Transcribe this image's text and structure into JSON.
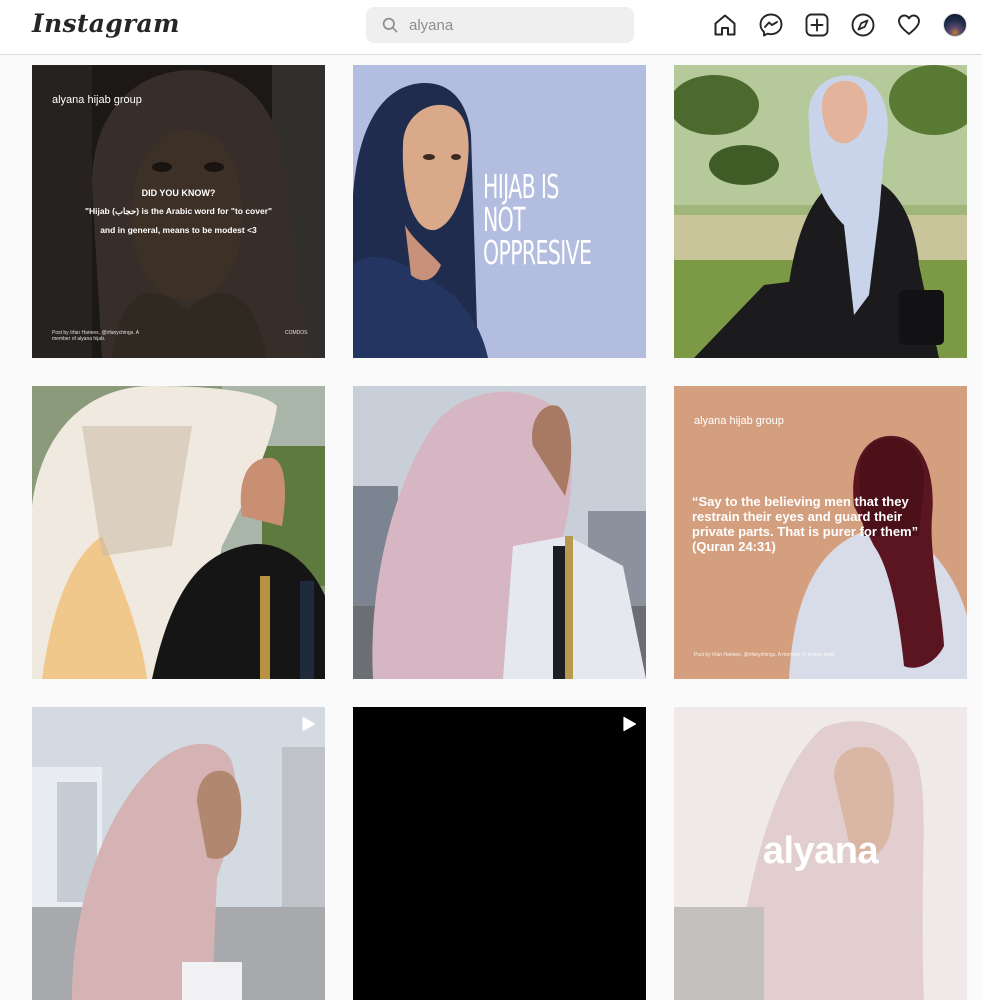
{
  "header": {
    "logo_text": "Instagram",
    "search_value": "alyana",
    "nav_icons": [
      "home-icon",
      "messenger-icon",
      "new-post-icon",
      "explore-icon",
      "activity-heart-icon",
      "profile-avatar"
    ]
  },
  "posts": [
    {
      "kind": "image",
      "brand": "alyana hijab group",
      "question": "DID YOU KNOW?",
      "line1": "\"Hijab (حجاب) is the Arabic word for \"to cover\"",
      "line2": "and in general, means to be modest <3",
      "credit": "Post by Irfan Hariees, @irfanychings. A member of alyana hijab.",
      "tag": "COMDOS"
    },
    {
      "kind": "image",
      "headline": "HIJAB IS NOT OPPRESIVE"
    },
    {
      "kind": "image"
    },
    {
      "kind": "image"
    },
    {
      "kind": "image"
    },
    {
      "kind": "image",
      "brand": "alyana hijab group",
      "quote": "“Say to the believing men that they restrain their eyes and guard their private parts. That is purer for them” (Quran 24:31)",
      "credit": "Post by Irfan Hariees, @irfanychings. A member of alyana hijab."
    },
    {
      "kind": "video"
    },
    {
      "kind": "video"
    },
    {
      "kind": "image",
      "wordmark": "alyana"
    }
  ],
  "colors": {
    "tile1_bg": "#b3bde0",
    "tile5_bg": "#d49f7e",
    "tile7_bg": "#000000"
  }
}
